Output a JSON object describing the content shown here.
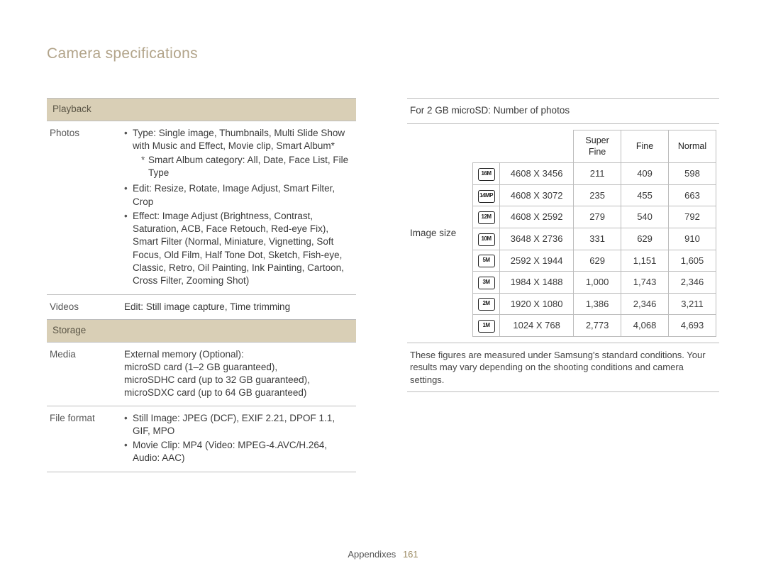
{
  "title": "Camera specifications",
  "footer": {
    "section": "Appendixes",
    "page": "161"
  },
  "left": {
    "sections": {
      "playback": "Playback",
      "storage": "Storage"
    },
    "rows": {
      "photos_label": "Photos",
      "photos_b1": "Type: Single image, Thumbnails, Multi Slide Show with Music and Effect, Movie clip, Smart Album*",
      "photos_s1": "Smart Album category: All, Date, Face List, File Type",
      "photos_b2": "Edit: Resize, Rotate, Image Adjust, Smart Filter, Crop",
      "photos_b3": "Effect: Image Adjust (Brightness, Contrast, Saturation, ACB, Face Retouch, Red-eye Fix), Smart Filter (Normal, Miniature, Vignetting, Soft Focus, Old Film, Half Tone Dot, Sketch, Fish-eye, Classic, Retro, Oil Painting, Ink Painting, Cartoon, Cross Filter, Zooming Shot)",
      "videos_label": "Videos",
      "videos_val": "Edit: Still image capture, Time trimming",
      "media_label": "Media",
      "media_l1": "External memory (Optional):",
      "media_l2": "microSD card (1–2 GB guaranteed),",
      "media_l3": "microSDHC card (up to 32 GB guaranteed),",
      "media_l4": "microSDXC card (up to 64 GB guaranteed)",
      "ff_label": "File format",
      "ff_b1": "Still Image: JPEG (DCF), EXIF 2.21, DPOF 1.1, GIF, MPO",
      "ff_b2": "Movie Clip: MP4 (Video: MPEG-4.AVC/H.264, Audio: AAC)"
    }
  },
  "right": {
    "header": "For 2 GB microSD: Number of photos",
    "imgsize_label": "Image size",
    "cols": {
      "c1": "Super Fine",
      "c2": "Fine",
      "c3": "Normal"
    },
    "chart_data": {
      "type": "table",
      "rows": [
        {
          "icon": "16M",
          "res": "4608 X 3456",
          "sf": "211",
          "f": "409",
          "n": "598"
        },
        {
          "icon": "14MP",
          "res": "4608 X 3072",
          "sf": "235",
          "f": "455",
          "n": "663"
        },
        {
          "icon": "12M",
          "res": "4608 X 2592",
          "sf": "279",
          "f": "540",
          "n": "792"
        },
        {
          "icon": "10M",
          "res": "3648 X 2736",
          "sf": "331",
          "f": "629",
          "n": "910"
        },
        {
          "icon": "5M",
          "res": "2592 X 1944",
          "sf": "629",
          "f": "1,151",
          "n": "1,605"
        },
        {
          "icon": "3M",
          "res": "1984 X 1488",
          "sf": "1,000",
          "f": "1,743",
          "n": "2,346"
        },
        {
          "icon": "2M",
          "res": "1920 X 1080",
          "sf": "1,386",
          "f": "2,346",
          "n": "3,211"
        },
        {
          "icon": "1M",
          "res": "1024 X 768",
          "sf": "2,773",
          "f": "4,068",
          "n": "4,693"
        }
      ]
    },
    "footnote": "These figures are measured under Samsung's standard conditions. Your results may vary depending on the shooting conditions and camera settings."
  }
}
